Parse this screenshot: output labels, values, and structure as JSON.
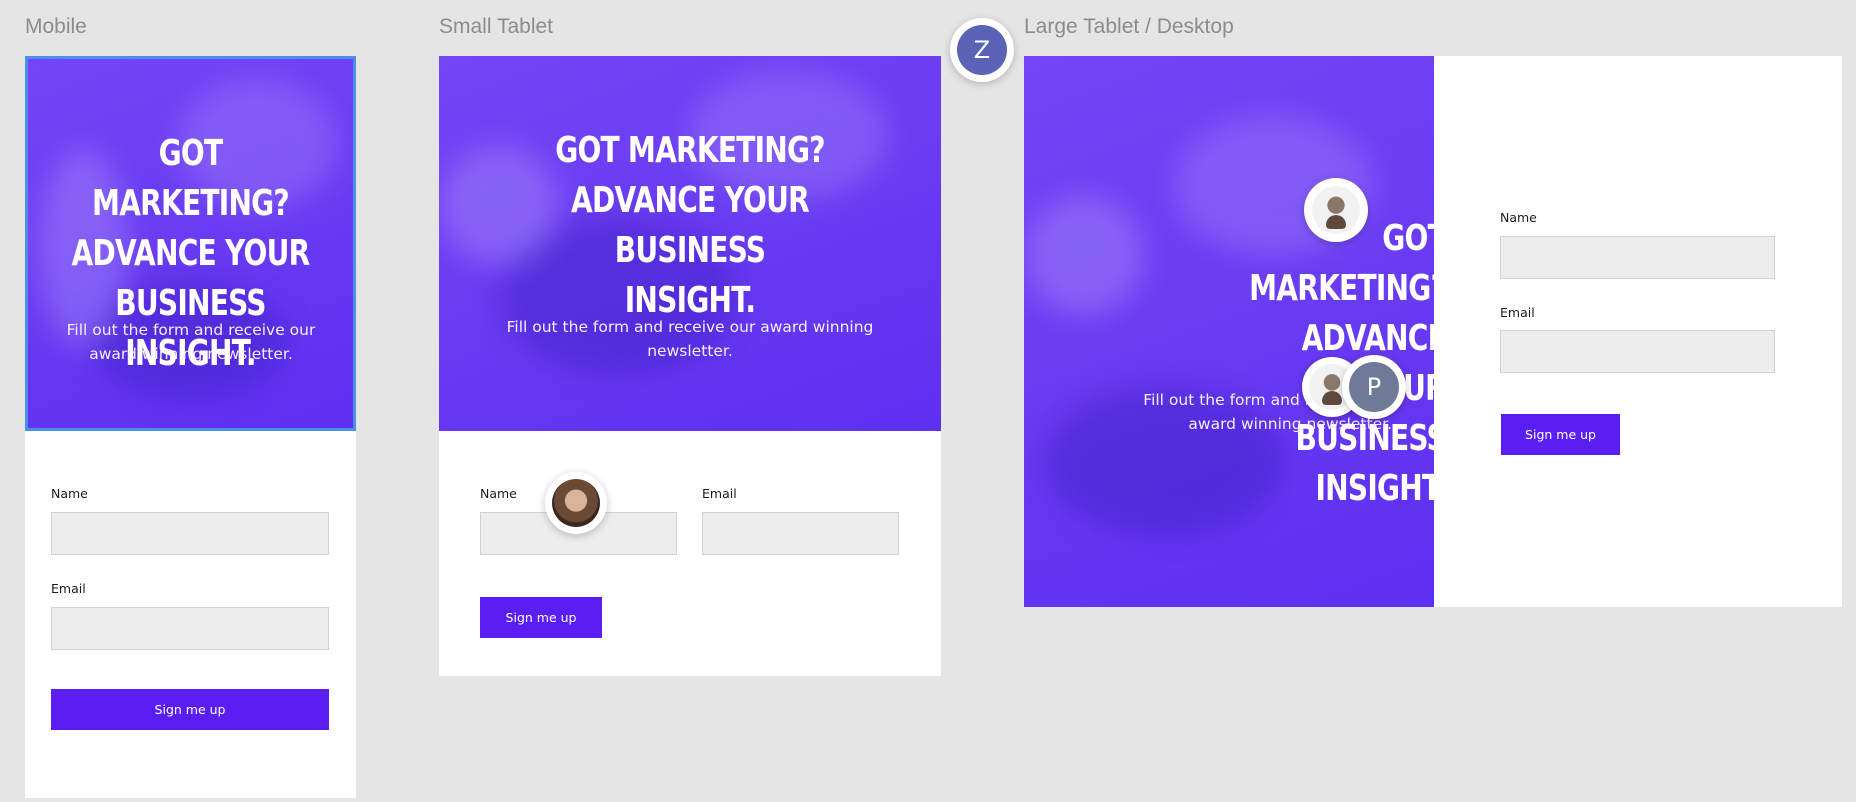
{
  "frames": {
    "mobile": {
      "label": "Mobile",
      "headline": "GOT MARKETING?\nADVANCE YOUR\nBUSINESS INSIGHT.",
      "subtext": "Fill out the form and receive our award winning newsletter.",
      "name_label": "Name",
      "email_label": "Email",
      "button_label": "Sign me up"
    },
    "small_tablet": {
      "label": "Small Tablet",
      "headline": "GOT MARKETING?\nADVANCE YOUR BUSINESS\nINSIGHT.",
      "subtext": "Fill out the form and receive our award winning newsletter.",
      "name_label": "Name",
      "email_label": "Email",
      "button_label": "Sign me up"
    },
    "desktop": {
      "label": "Large Tablet / Desktop",
      "headline": "GOT MARKETING?\nADVANCE YOUR\nBUSINESS INSIGHT.",
      "subtext": "Fill out the form and receive our award winning newsletter.",
      "name_label": "Name",
      "email_label": "Email",
      "button_label": "Sign me up"
    }
  },
  "collaborators": {
    "z_initial": "Z",
    "p_initial": "P",
    "photo_person_1": "person-photo",
    "photo_person_2": "person-photo",
    "photo_person_3": "person-photo"
  },
  "colors": {
    "hero": "#6a3cf2",
    "button": "#5b1ef2",
    "selection": "#4a90e8",
    "avatar_z": "#5b63b7",
    "avatar_p": "#6f7a96"
  }
}
